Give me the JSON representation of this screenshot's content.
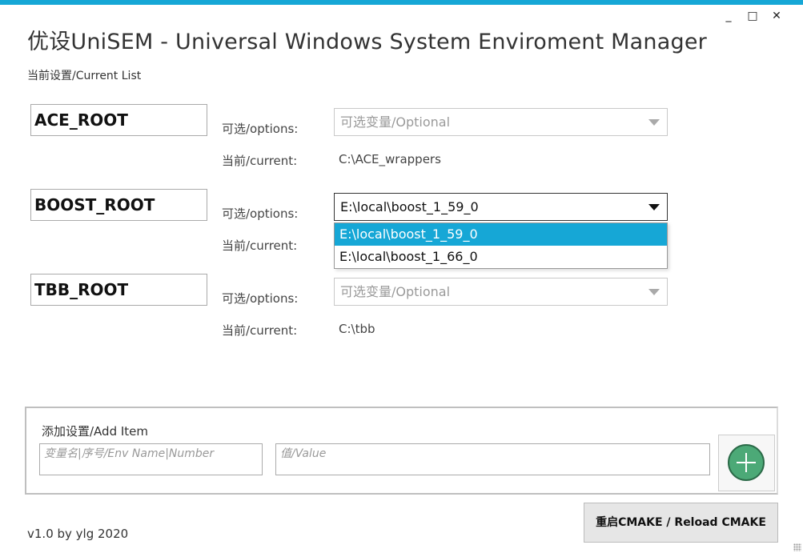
{
  "window": {
    "title": "优设UniSEM - Universal Windows System Enviroment Manager",
    "controls": {
      "minimize": "_",
      "maximize": "□",
      "close": "✕"
    }
  },
  "current_list_label": "当前设置/Current List",
  "options_label": "可选/options:",
  "current_label": "当前/current:",
  "entries": [
    {
      "name": "ACE_ROOT",
      "combo_value": "可选变量/Optional",
      "current": "C:\\ACE_wrappers"
    },
    {
      "name": "BOOST_ROOT",
      "combo_value": "E:\\local\\boost_1_59_0",
      "current": ""
    },
    {
      "name": "TBB_ROOT",
      "combo_value": "可选变量/Optional",
      "current": "C:\\tbb"
    }
  ],
  "dropdown": {
    "options": [
      "E:\\local\\boost_1_59_0",
      "E:\\local\\boost_1_66_0"
    ],
    "selected_index": 0
  },
  "add_item": {
    "title": "添加设置/Add Item",
    "name_placeholder": "变量名|序号/Env Name|Number",
    "value_placeholder": "值/Value"
  },
  "footer": {
    "version": "v1.0 by ylg 2020",
    "reload_button": "重启CMAKE / Reload CMAKE"
  },
  "colors": {
    "accent": "#16a7d6",
    "add_button": "#4ca977"
  },
  "icons": {
    "add": "plus-circle-icon",
    "dropdown": "chevron-down-icon"
  }
}
